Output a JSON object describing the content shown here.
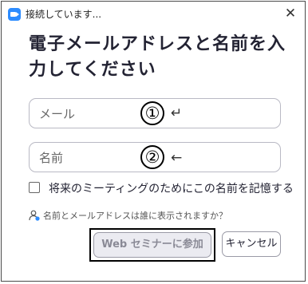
{
  "window": {
    "title": "接続しています...",
    "close_symbol": "✕"
  },
  "heading": "電子メールアドレスと名前を入力してください",
  "email_field": {
    "placeholder": "メール",
    "value": ""
  },
  "name_field": {
    "placeholder": "名前",
    "value": ""
  },
  "annotations": [
    {
      "number": "①",
      "arrow": "↵"
    },
    {
      "number": "②",
      "arrow": "←"
    }
  ],
  "remember_checkbox": {
    "label": "将来のミーティングのためにこの名前を記憶する",
    "checked": false
  },
  "help_link": "名前とメールアドレスは誰に表示されますか？",
  "buttons": {
    "join": "Web セミナーに参加",
    "cancel": "キャンセル"
  },
  "colors": {
    "accent": "#2d8cff",
    "text": "#232333",
    "border": "#b9b9c4",
    "disabled_bg": "#ebebf1"
  },
  "icons": [
    "zoom-app-icon",
    "close-icon",
    "checkbox-icon",
    "person-info-icon"
  ]
}
